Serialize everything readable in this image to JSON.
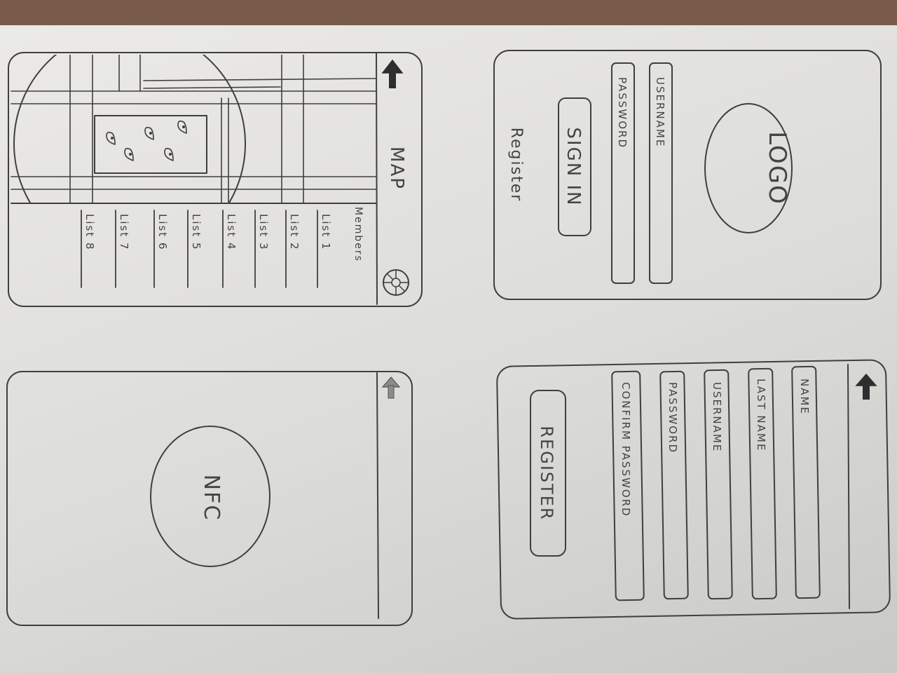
{
  "login": {
    "logo_text": "LOGO",
    "username_label": "USERNAME",
    "password_label": "PASSWORD",
    "sign_in_label": "SIGN IN",
    "register_link": "Register"
  },
  "register": {
    "back_icon": "arrow-back-icon",
    "name_label": "NAME",
    "last_name_label": "LAST NAME",
    "username_label": "USERNAME",
    "password_label": "PASSWORD",
    "confirm_password_label": "CONFIRM PASSWORD",
    "register_label": "REGISTER"
  },
  "map": {
    "back_icon": "arrow-back-icon",
    "title": "MAP",
    "members_heading": "Members",
    "settings_icon": "gear-icon",
    "members": [
      "List 1",
      "List 2",
      "List 3",
      "List 4",
      "List 5",
      "List 6",
      "List 7",
      "List 8"
    ]
  },
  "nfc": {
    "back_icon": "arrow-back-icon",
    "label": "NFC"
  }
}
